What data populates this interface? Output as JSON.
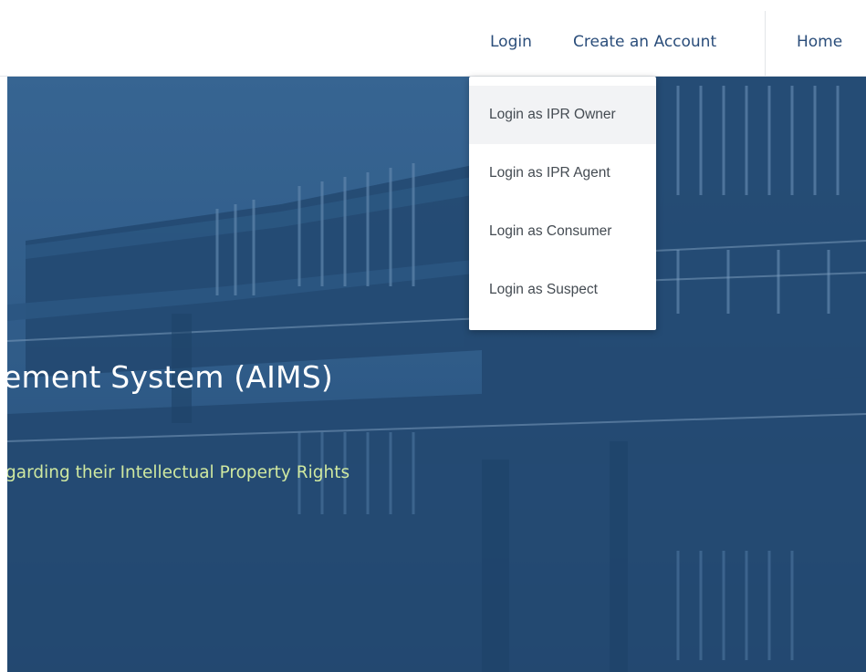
{
  "nav": {
    "login_label": "Login",
    "create_account_label": "Create an Account",
    "home_label": "Home"
  },
  "hero": {
    "title": "ement System (AIMS)",
    "subtitle": "garding their Intellectual Property Rights"
  },
  "login_menu": {
    "items": [
      {
        "label": "Login as IPR Owner",
        "hovered": true
      },
      {
        "label": "Login as IPR Agent",
        "hovered": false
      },
      {
        "label": "Login as Consumer",
        "hovered": false
      },
      {
        "label": "Login as Suspect",
        "hovered": false
      }
    ]
  },
  "colors": {
    "nav_link": "#2a4d7a",
    "hero_overlay": "#2f5b88",
    "subtitle": "#cfe8a0",
    "menu_text": "#444b52",
    "menu_hover": "#f2f3f5"
  }
}
